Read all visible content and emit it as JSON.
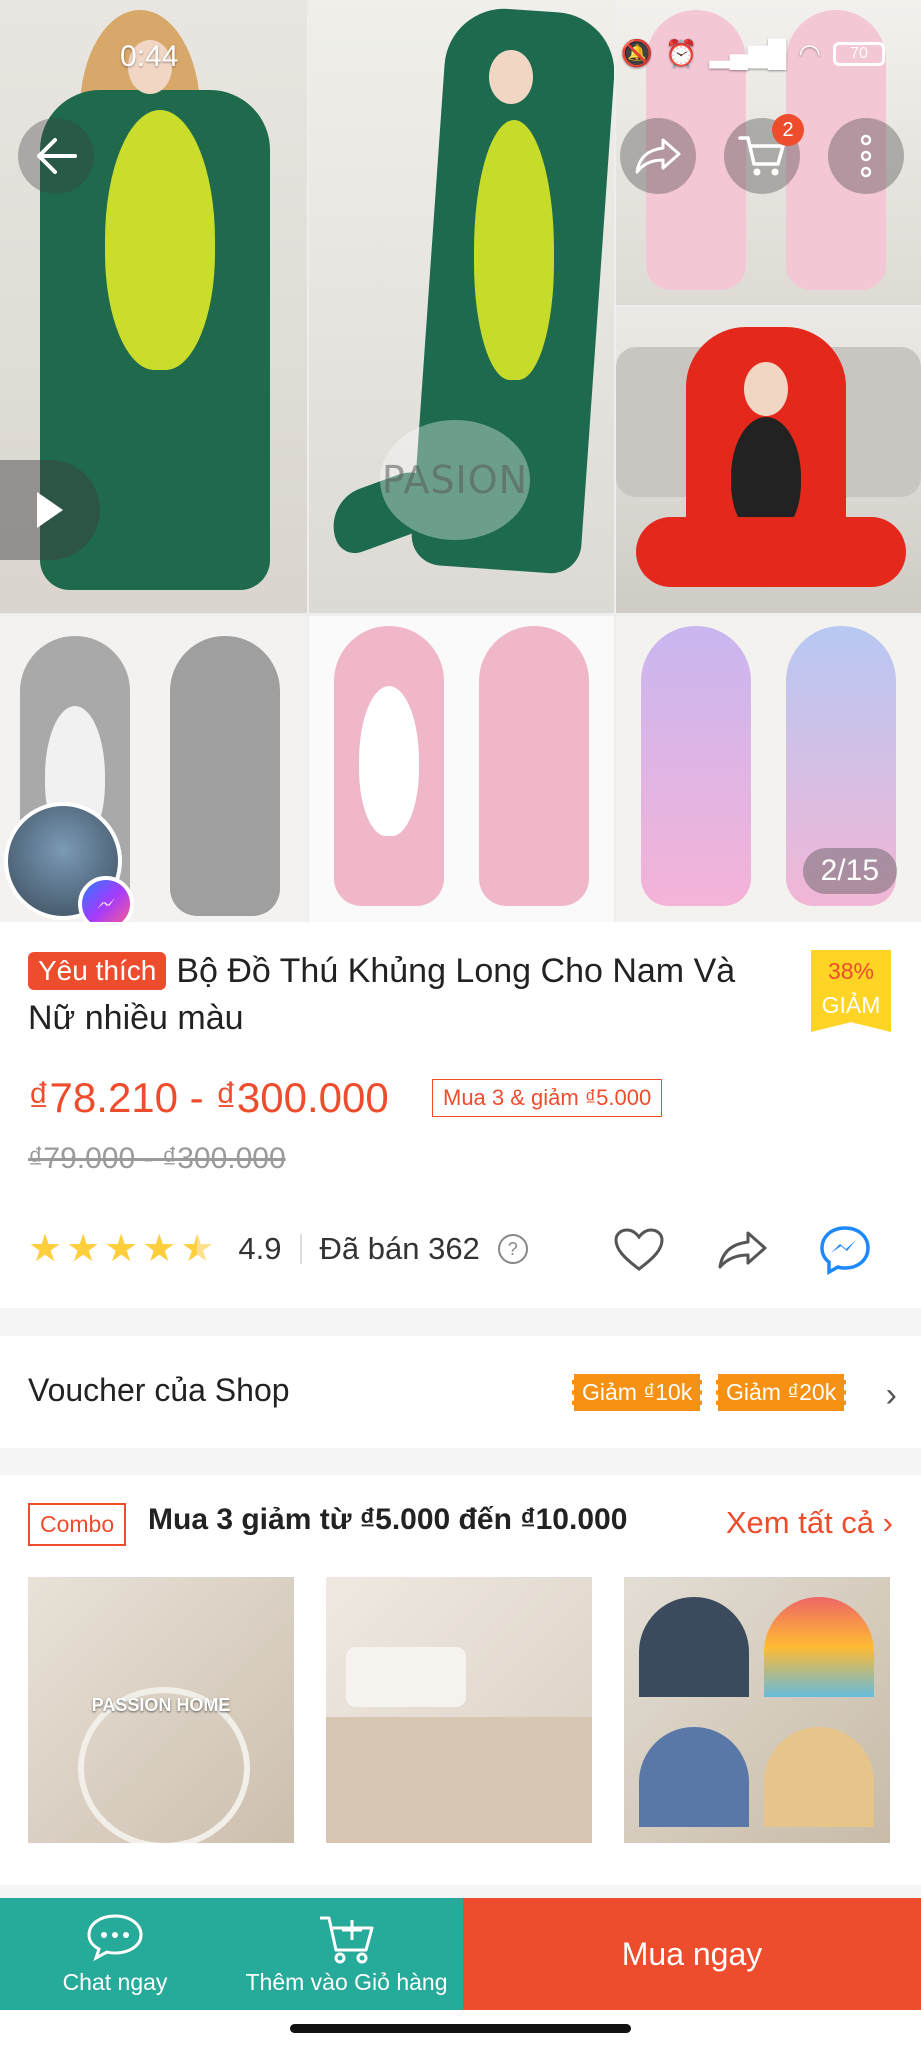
{
  "status_bar": {
    "time": "0:44",
    "battery": "70"
  },
  "gallery": {
    "counter": "2/15",
    "watermark": "PASION",
    "cart_count": "2"
  },
  "product": {
    "favorite_tag": "Yêu thích",
    "title": "Bộ Đồ Thú Khủng Long Cho Nam Và Nữ nhiều màu",
    "discount_percent": "38%",
    "discount_label": "GIẢM",
    "price": "₫78.210 - ₫300.000",
    "promo": "Mua 3 & giảm ₫5.000",
    "original_price": "₫79.000 - ₫300.000",
    "rating": "4.9",
    "rating_stars": 4.5,
    "sold": "Đã bán 362"
  },
  "voucher": {
    "label": "Voucher của Shop",
    "chips": [
      "Giảm ₫10k",
      "Giảm ₫20k"
    ]
  },
  "combo": {
    "badge": "Combo",
    "title": "Mua 3 giảm từ ₫5.000 đến ₫10.000",
    "see_all": "Xem tất cả",
    "thumb_label": "PASSION HOME"
  },
  "bottom_bar": {
    "chat": "Chat ngay",
    "add_to_cart": "Thêm vào Giỏ hàng",
    "buy_now": "Mua ngay"
  },
  "colors": {
    "accent": "#ee4d2d",
    "teal": "#26aa99",
    "star": "#ffce3d",
    "voucher": "#f69113"
  }
}
